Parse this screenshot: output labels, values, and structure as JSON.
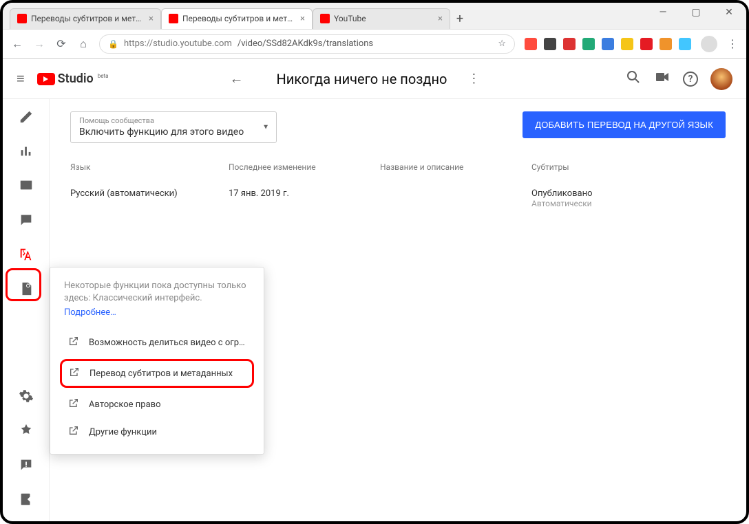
{
  "browser": {
    "tabs": [
      {
        "title": "Переводы субтитров и метадан",
        "active": false
      },
      {
        "title": "Переводы субтитров и метадан",
        "active": true
      },
      {
        "title": "YouTube",
        "active": false
      }
    ],
    "url_host": "https://studio.youtube.com",
    "url_path": "/video/SSd82AKdk9s/translations"
  },
  "header": {
    "logo_text": "Studio",
    "logo_beta": "beta",
    "video_title": "Никогда ничего не поздно"
  },
  "community_select": {
    "label": "Помощь сообщества",
    "value": "Включить функцию для этого видео"
  },
  "add_button": "ДОБАВИТЬ ПЕРЕВОД НА ДРУГОЙ ЯЗЫК",
  "columns": {
    "lang": "Язык",
    "modified": "Последнее изменение",
    "desc": "Название и описание",
    "subs": "Субтитры"
  },
  "row": {
    "lang": "Русский (автоматически)",
    "modified": "17 янв. 2019 г.",
    "desc": "",
    "sub_status": "Опубликовано",
    "sub_auto": "Автоматически"
  },
  "menu": {
    "intro": "Некоторые функции пока доступны только здесь: Классический интерфейс.",
    "more": "Подробнее…",
    "items": [
      "Возможность делиться видео с огр…",
      "Перевод субтитров и метаданных",
      "Авторское право",
      "Другие функции"
    ]
  }
}
